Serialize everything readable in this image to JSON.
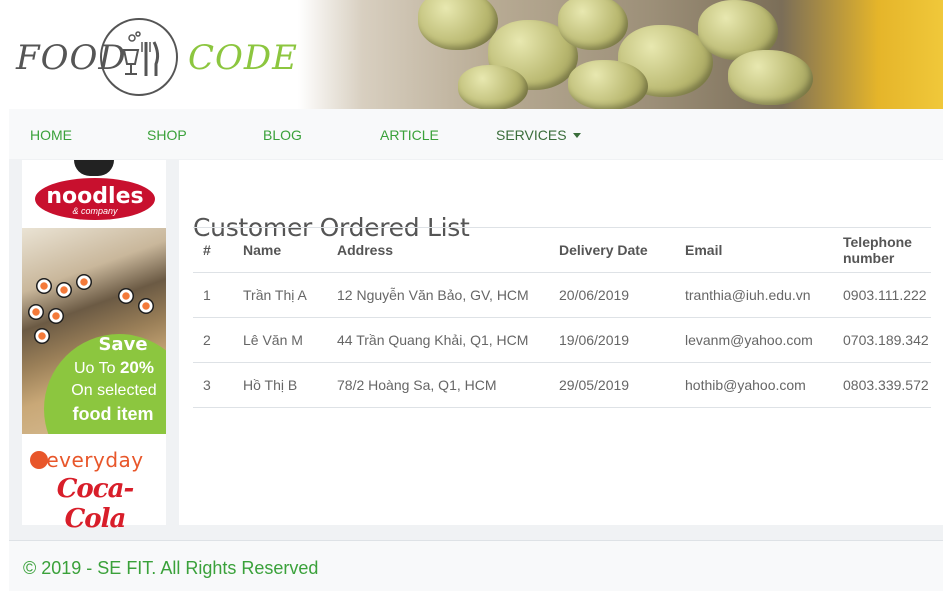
{
  "header": {
    "logo_left": "FOOD",
    "logo_right": "CODE"
  },
  "nav": {
    "items": [
      {
        "label": "HOME"
      },
      {
        "label": "SHOP"
      },
      {
        "label": "BLOG"
      },
      {
        "label": "ARTICLE"
      },
      {
        "label": "SERVICES"
      }
    ]
  },
  "sidebar_ad": {
    "brand": "noodles",
    "brand_sub": "& company",
    "save": "Save",
    "upto_prefix": "Uo To ",
    "upto_value": "20%",
    "on_selected": "On selected",
    "food_item": "food item",
    "everyday": "everyday",
    "coke": "Coca-Cola",
    "colors": {
      "green": "#8cc63f",
      "noodles_red": "#c8102e",
      "everyday_orange": "#e8562a",
      "coke_red": "#d81e2a"
    }
  },
  "main": {
    "title": "Customer Ordered List",
    "table": {
      "headers": [
        "#",
        "Name",
        "Address",
        "Delivery Date",
        "Email",
        "Telephone number"
      ],
      "rows": [
        [
          "1",
          "Trần Thị A",
          "12 Nguyễn Văn Bảo, GV, HCM",
          "20/06/2019",
          "tranthia@iuh.edu.vn",
          "0903.111.222"
        ],
        [
          "2",
          "Lê Văn M",
          "44 Trần Quang Khải, Q1, HCM",
          "19/06/2019",
          "levanm@yahoo.com",
          "0703.189.342"
        ],
        [
          "3",
          "Hồ Thị B",
          "78/2 Hoàng Sa, Q1, HCM",
          "29/05/2019",
          "hothib@yahoo.com",
          "0803.339.572"
        ]
      ]
    }
  },
  "footer": {
    "text": "© 2019 - SE FIT. All Rights Reserved"
  },
  "colors": {
    "accent_green": "#3aa13a",
    "nav_bg": "#f8f9fa"
  }
}
